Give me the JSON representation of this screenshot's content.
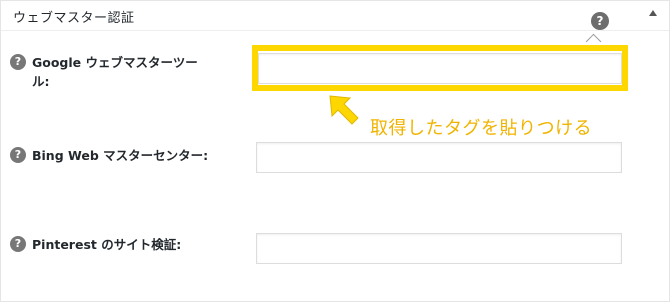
{
  "panel": {
    "title": "ウェブマスター認証",
    "help_symbol": "?"
  },
  "rows": [
    {
      "label_line1": "Google ウェブマスターツー",
      "label_line2": "ル:",
      "help_symbol": "?",
      "value": ""
    },
    {
      "label": "Bing Web マスターセンター:",
      "help_symbol": "?",
      "value": ""
    },
    {
      "label": "Pinterest のサイト検証:",
      "help_symbol": "?",
      "value": ""
    }
  ],
  "annotation": {
    "text": "取得したタグを貼りつける",
    "color": "#f0b400",
    "highlight_color": "#ffd700"
  },
  "icons": {
    "help": "question-circle-icon",
    "collapse": "triangle-up-icon",
    "pointer": "arrow-up-left-icon"
  }
}
